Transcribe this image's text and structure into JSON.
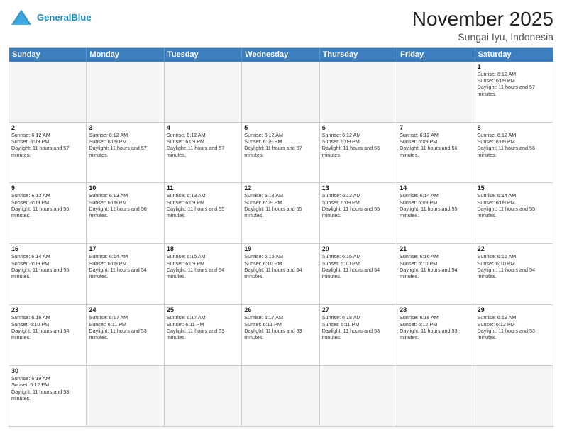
{
  "header": {
    "logo_general": "General",
    "logo_blue": "Blue",
    "title": "November 2025",
    "subtitle": "Sungai Iyu, Indonesia"
  },
  "calendar": {
    "days_of_week": [
      "Sunday",
      "Monday",
      "Tuesday",
      "Wednesday",
      "Thursday",
      "Friday",
      "Saturday"
    ],
    "weeks": [
      [
        {
          "day": "",
          "empty": true
        },
        {
          "day": "",
          "empty": true
        },
        {
          "day": "",
          "empty": true
        },
        {
          "day": "",
          "empty": true
        },
        {
          "day": "",
          "empty": true
        },
        {
          "day": "",
          "empty": true
        },
        {
          "day": "1",
          "sunrise": "Sunrise: 6:12 AM",
          "sunset": "Sunset: 6:09 PM",
          "daylight": "Daylight: 11 hours and 57 minutes."
        }
      ],
      [
        {
          "day": "2",
          "sunrise": "Sunrise: 6:12 AM",
          "sunset": "Sunset: 6:09 PM",
          "daylight": "Daylight: 11 hours and 57 minutes."
        },
        {
          "day": "3",
          "sunrise": "Sunrise: 6:12 AM",
          "sunset": "Sunset: 6:09 PM",
          "daylight": "Daylight: 11 hours and 57 minutes."
        },
        {
          "day": "4",
          "sunrise": "Sunrise: 6:12 AM",
          "sunset": "Sunset: 6:09 PM",
          "daylight": "Daylight: 11 hours and 57 minutes."
        },
        {
          "day": "5",
          "sunrise": "Sunrise: 6:12 AM",
          "sunset": "Sunset: 6:09 PM",
          "daylight": "Daylight: 11 hours and 57 minutes."
        },
        {
          "day": "6",
          "sunrise": "Sunrise: 6:12 AM",
          "sunset": "Sunset: 6:09 PM",
          "daylight": "Daylight: 11 hours and 56 minutes."
        },
        {
          "day": "7",
          "sunrise": "Sunrise: 6:12 AM",
          "sunset": "Sunset: 6:09 PM",
          "daylight": "Daylight: 11 hours and 56 minutes."
        },
        {
          "day": "8",
          "sunrise": "Sunrise: 6:12 AM",
          "sunset": "Sunset: 6:09 PM",
          "daylight": "Daylight: 11 hours and 56 minutes."
        }
      ],
      [
        {
          "day": "9",
          "sunrise": "Sunrise: 6:13 AM",
          "sunset": "Sunset: 6:09 PM",
          "daylight": "Daylight: 11 hours and 56 minutes."
        },
        {
          "day": "10",
          "sunrise": "Sunrise: 6:13 AM",
          "sunset": "Sunset: 6:09 PM",
          "daylight": "Daylight: 11 hours and 56 minutes."
        },
        {
          "day": "11",
          "sunrise": "Sunrise: 6:13 AM",
          "sunset": "Sunset: 6:09 PM",
          "daylight": "Daylight: 11 hours and 55 minutes."
        },
        {
          "day": "12",
          "sunrise": "Sunrise: 6:13 AM",
          "sunset": "Sunset: 6:09 PM",
          "daylight": "Daylight: 11 hours and 55 minutes."
        },
        {
          "day": "13",
          "sunrise": "Sunrise: 6:13 AM",
          "sunset": "Sunset: 6:09 PM",
          "daylight": "Daylight: 11 hours and 55 minutes."
        },
        {
          "day": "14",
          "sunrise": "Sunrise: 6:14 AM",
          "sunset": "Sunset: 6:09 PM",
          "daylight": "Daylight: 11 hours and 55 minutes."
        },
        {
          "day": "15",
          "sunrise": "Sunrise: 6:14 AM",
          "sunset": "Sunset: 6:09 PM",
          "daylight": "Daylight: 11 hours and 55 minutes."
        }
      ],
      [
        {
          "day": "16",
          "sunrise": "Sunrise: 6:14 AM",
          "sunset": "Sunset: 6:09 PM",
          "daylight": "Daylight: 11 hours and 55 minutes."
        },
        {
          "day": "17",
          "sunrise": "Sunrise: 6:14 AM",
          "sunset": "Sunset: 6:09 PM",
          "daylight": "Daylight: 11 hours and 54 minutes."
        },
        {
          "day": "18",
          "sunrise": "Sunrise: 6:15 AM",
          "sunset": "Sunset: 6:09 PM",
          "daylight": "Daylight: 11 hours and 54 minutes."
        },
        {
          "day": "19",
          "sunrise": "Sunrise: 6:15 AM",
          "sunset": "Sunset: 6:10 PM",
          "daylight": "Daylight: 11 hours and 54 minutes."
        },
        {
          "day": "20",
          "sunrise": "Sunrise: 6:15 AM",
          "sunset": "Sunset: 6:10 PM",
          "daylight": "Daylight: 11 hours and 54 minutes."
        },
        {
          "day": "21",
          "sunrise": "Sunrise: 6:16 AM",
          "sunset": "Sunset: 6:10 PM",
          "daylight": "Daylight: 11 hours and 54 minutes."
        },
        {
          "day": "22",
          "sunrise": "Sunrise: 6:16 AM",
          "sunset": "Sunset: 6:10 PM",
          "daylight": "Daylight: 11 hours and 54 minutes."
        }
      ],
      [
        {
          "day": "23",
          "sunrise": "Sunrise: 6:16 AM",
          "sunset": "Sunset: 6:10 PM",
          "daylight": "Daylight: 11 hours and 54 minutes."
        },
        {
          "day": "24",
          "sunrise": "Sunrise: 6:17 AM",
          "sunset": "Sunset: 6:11 PM",
          "daylight": "Daylight: 11 hours and 53 minutes."
        },
        {
          "day": "25",
          "sunrise": "Sunrise: 6:17 AM",
          "sunset": "Sunset: 6:11 PM",
          "daylight": "Daylight: 11 hours and 53 minutes."
        },
        {
          "day": "26",
          "sunrise": "Sunrise: 6:17 AM",
          "sunset": "Sunset: 6:11 PM",
          "daylight": "Daylight: 11 hours and 53 minutes."
        },
        {
          "day": "27",
          "sunrise": "Sunrise: 6:18 AM",
          "sunset": "Sunset: 6:11 PM",
          "daylight": "Daylight: 11 hours and 53 minutes."
        },
        {
          "day": "28",
          "sunrise": "Sunrise: 6:18 AM",
          "sunset": "Sunset: 6:12 PM",
          "daylight": "Daylight: 11 hours and 53 minutes."
        },
        {
          "day": "29",
          "sunrise": "Sunrise: 6:19 AM",
          "sunset": "Sunset: 6:12 PM",
          "daylight": "Daylight: 11 hours and 53 minutes."
        }
      ],
      [
        {
          "day": "30",
          "sunrise": "Sunrise: 6:19 AM",
          "sunset": "Sunset: 6:12 PM",
          "daylight": "Daylight: 11 hours and 53 minutes."
        },
        {
          "day": "",
          "empty": true
        },
        {
          "day": "",
          "empty": true
        },
        {
          "day": "",
          "empty": true
        },
        {
          "day": "",
          "empty": true
        },
        {
          "day": "",
          "empty": true
        },
        {
          "day": "",
          "empty": true
        }
      ]
    ]
  }
}
